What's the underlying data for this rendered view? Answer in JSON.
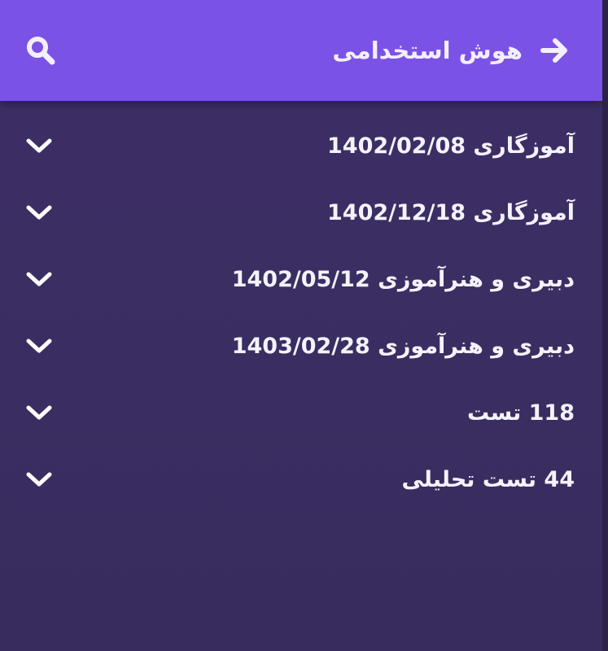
{
  "header": {
    "title": "هوش استخدامی",
    "back_icon": "arrow-right-icon",
    "search_icon": "search-icon",
    "bg_color": "#7b52e6"
  },
  "list": {
    "items": [
      {
        "label": "آموزگاری 1402/02/08",
        "icon": "chevron-down-icon"
      },
      {
        "label": "آموزگاری 1402/12/18",
        "icon": "chevron-down-icon"
      },
      {
        "label": "دبیری و هنرآموزی 1402/05/12",
        "icon": "chevron-down-icon"
      },
      {
        "label": "دبیری و هنرآموزی 1403/02/28",
        "icon": "chevron-down-icon"
      },
      {
        "label": "118 تست",
        "icon": "chevron-down-icon"
      },
      {
        "label": "44 تست تحلیلی",
        "icon": "chevron-down-icon"
      }
    ],
    "bg_color": "#3c2f64"
  }
}
